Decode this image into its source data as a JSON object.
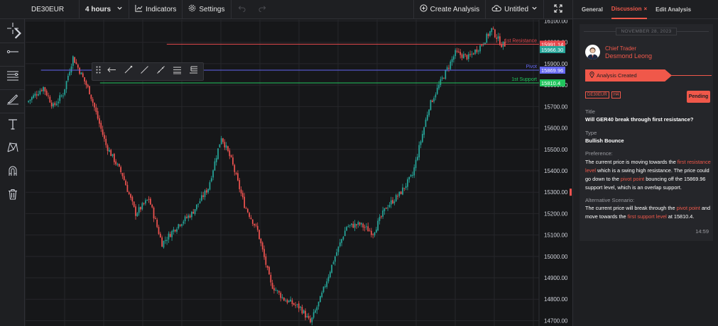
{
  "toolbar": {
    "symbol": "DE30EUR",
    "interval": "4 hours",
    "indicators_label": "Indicators",
    "settings_label": "Settings",
    "create_analysis_label": "Create Analysis",
    "untitled_label": "Untitled"
  },
  "chart": {
    "price_axis": [
      "16100.00",
      "16000.00",
      "15900.00",
      "15800.00",
      "15700.00",
      "15600.00",
      "15500.00",
      "15400.00",
      "15300.00",
      "15200.00",
      "15100.00",
      "15000.00",
      "14900.00",
      "14800.00",
      "14700.00"
    ],
    "price_range": [
      14675,
      16105
    ],
    "lines": [
      {
        "name": "1st Resistance",
        "price": 15991.14,
        "color": "#e5484d",
        "start_fraction": 0.275
      },
      {
        "name": "Pivot",
        "price": 15869.96,
        "color": "#6366f1",
        "start_fraction": 0.03
      },
      {
        "name": "1st Support",
        "price": 15810.4,
        "color": "#22c55e",
        "start_fraction": 0.145
      }
    ],
    "current_price": "15966.30",
    "current_price_value": 15966.3,
    "up_color": "#26a69a",
    "down_color": "#ef5350"
  },
  "panel": {
    "tabs": [
      "General",
      "Discussion",
      "Edit Analysis"
    ],
    "active_tab": "Discussion",
    "close_glyph": "×",
    "date": "NOVEMBER 28, 2023",
    "role": "Chief Trader",
    "author": "Desmond Leong",
    "status_label": "Analysis Created",
    "badges": [
      "DE30EUR",
      "H4"
    ],
    "status_button": "Pending",
    "title_label": "Title",
    "title_value": "Will GER40 break through first resistance?",
    "type_label": "Type",
    "type_value": "Bullish Bounce",
    "preference_label": "Preference:",
    "preference": {
      "t1": "The current price is moving towards the ",
      "h1": "first resistance level",
      "t2": " which is a swing high resistance. The price could go down to the ",
      "h2": "pivot point",
      "t3": " bouncing off the 15869.96 support level, which is an overlap support."
    },
    "alt_label": "Alternative Scenario:",
    "alternative": {
      "t1": "The current price will break through the ",
      "h1": "pivot point",
      "t2": " and move towards the ",
      "h2": "first support level",
      "t3": " at 15810.4."
    },
    "time": "14:59"
  }
}
